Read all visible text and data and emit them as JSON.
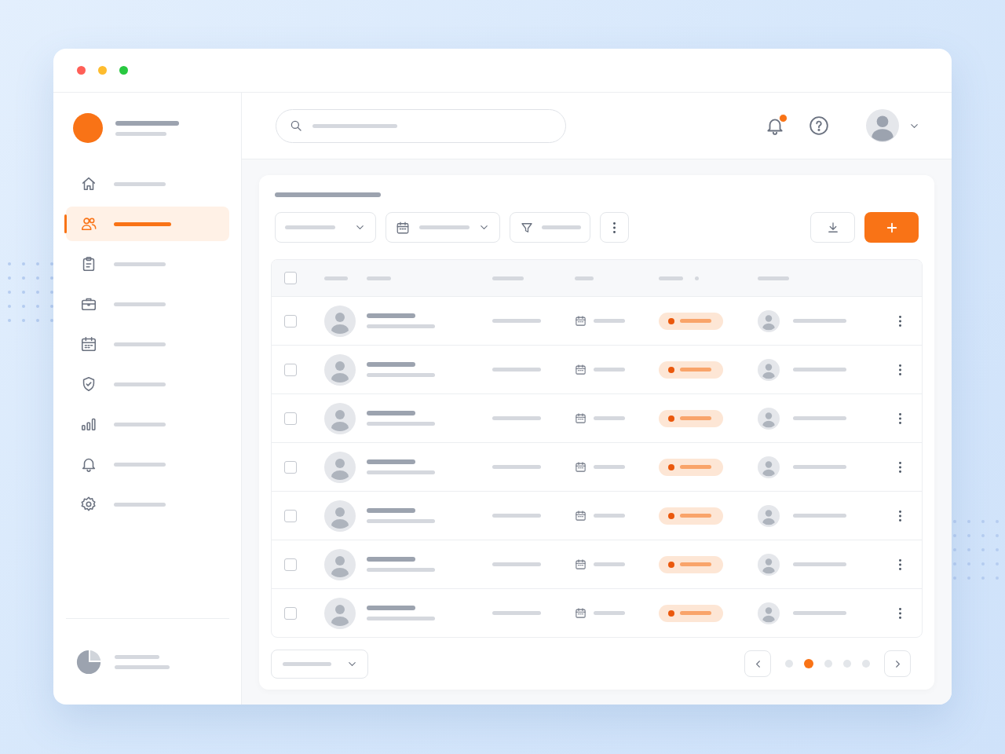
{
  "window": {
    "controls": [
      {
        "color": "#ff5f57"
      },
      {
        "color": "#febc2e"
      },
      {
        "color": "#28c840"
      }
    ]
  },
  "header": {
    "notifications": {
      "unread": true
    }
  },
  "sidebar": {
    "items": [
      {
        "kind": "home",
        "selected": false
      },
      {
        "kind": "users",
        "selected": true
      },
      {
        "kind": "clipboard",
        "selected": false
      },
      {
        "kind": "briefcase",
        "selected": false
      },
      {
        "kind": "calendar",
        "selected": false
      },
      {
        "kind": "shield",
        "selected": false
      },
      {
        "kind": "chart",
        "selected": false
      },
      {
        "kind": "bell",
        "selected": false
      },
      {
        "kind": "settings",
        "selected": false
      }
    ]
  },
  "table": {
    "select_all": {
      "checked": false
    },
    "rows": [
      {
        "checked": false
      },
      {
        "checked": false
      },
      {
        "checked": false
      },
      {
        "checked": false
      },
      {
        "checked": false
      },
      {
        "checked": false
      },
      {
        "checked": false
      }
    ]
  },
  "pagination": {
    "pages": [
      {
        "selected": false
      },
      {
        "selected": true
      },
      {
        "selected": false
      },
      {
        "selected": false
      },
      {
        "selected": false
      }
    ]
  }
}
